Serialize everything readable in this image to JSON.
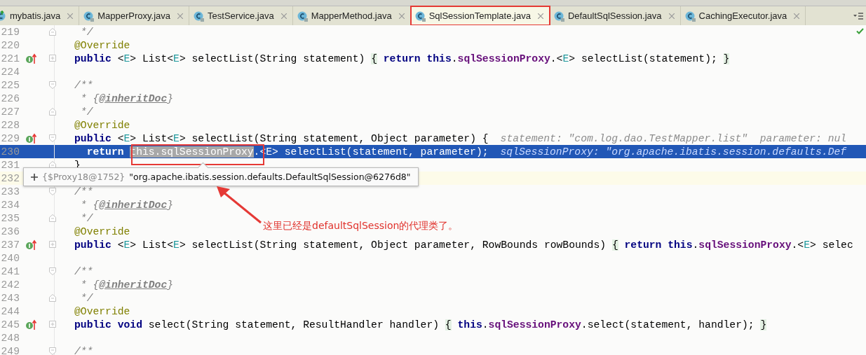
{
  "tabs": [
    {
      "label": "mybatis.java",
      "runnable": true,
      "selected": false,
      "highlighted": false
    },
    {
      "label": "MapperProxy.java",
      "runnable": false,
      "selected": false,
      "highlighted": false
    },
    {
      "label": "TestService.java",
      "runnable": false,
      "selected": false,
      "highlighted": false
    },
    {
      "label": "MapperMethod.java",
      "runnable": false,
      "selected": false,
      "highlighted": false
    },
    {
      "label": "SqlSessionTemplate.java",
      "runnable": false,
      "selected": true,
      "highlighted": true
    },
    {
      "label": "DefaultSqlSession.java",
      "runnable": false,
      "selected": false,
      "highlighted": false
    },
    {
      "label": "CachingExecutor.java",
      "runnable": false,
      "selected": false,
      "highlighted": false
    }
  ],
  "editor": {
    "lines": [
      {
        "number": "219",
        "implements": false,
        "fold_start": false,
        "fold_end": true,
        "collapsed": false,
        "selected": false,
        "caret": false,
        "tokens": [
          {
            "kind": "comment",
            "text": " */"
          }
        ]
      },
      {
        "number": "220",
        "implements": false,
        "fold_start": false,
        "fold_end": false,
        "collapsed": false,
        "selected": false,
        "caret": false,
        "tokens": [
          {
            "kind": "annotation",
            "text": "@Override"
          }
        ]
      },
      {
        "number": "221",
        "implements": true,
        "fold_start": false,
        "fold_end": false,
        "collapsed": true,
        "selected": false,
        "caret": false,
        "tokens": [
          {
            "kind": "keyword",
            "text": "public"
          },
          {
            "kind": "plain",
            "text": " <"
          },
          {
            "kind": "type",
            "text": "E"
          },
          {
            "kind": "plain",
            "text": "> List<"
          },
          {
            "kind": "type",
            "text": "E"
          },
          {
            "kind": "plain",
            "text": "> selectList(String statement) "
          },
          {
            "kind": "brace",
            "text": "{"
          },
          {
            "kind": "keyword",
            "text": " return this"
          },
          {
            "kind": "plain",
            "text": "."
          },
          {
            "kind": "field",
            "text": "sqlSessionProxy"
          },
          {
            "kind": "plain",
            "text": ".<"
          },
          {
            "kind": "type",
            "text": "E"
          },
          {
            "kind": "plain",
            "text": "> selectList(statement); "
          },
          {
            "kind": "brace",
            "text": "}"
          }
        ]
      },
      {
        "number": "224",
        "implements": false,
        "fold_start": false,
        "fold_end": false,
        "collapsed": false,
        "selected": false,
        "caret": false
      },
      {
        "number": "225",
        "implements": false,
        "fold_start": true,
        "fold_end": false,
        "collapsed": false,
        "selected": false,
        "caret": false,
        "tokens": [
          {
            "kind": "comment",
            "text": "/**"
          }
        ]
      },
      {
        "number": "226",
        "implements": false,
        "fold_start": false,
        "fold_end": false,
        "collapsed": false,
        "selected": false,
        "caret": false,
        "tokens": [
          {
            "kind": "comment",
            "text": " * {"
          },
          {
            "kind": "doctag",
            "text": "@inheritDoc"
          },
          {
            "kind": "comment",
            "text": "}"
          }
        ]
      },
      {
        "number": "227",
        "implements": false,
        "fold_start": false,
        "fold_end": true,
        "collapsed": false,
        "selected": false,
        "caret": false,
        "tokens": [
          {
            "kind": "comment",
            "text": " */"
          }
        ]
      },
      {
        "number": "228",
        "implements": false,
        "fold_start": false,
        "fold_end": false,
        "collapsed": false,
        "selected": false,
        "caret": false,
        "tokens": [
          {
            "kind": "annotation",
            "text": "@Override"
          }
        ]
      },
      {
        "number": "229",
        "implements": true,
        "fold_start": true,
        "fold_end": false,
        "collapsed": false,
        "selected": false,
        "caret": false,
        "tokens": [
          {
            "kind": "keyword",
            "text": "public"
          },
          {
            "kind": "plain",
            "text": " <"
          },
          {
            "kind": "type",
            "text": "E"
          },
          {
            "kind": "plain",
            "text": "> List<"
          },
          {
            "kind": "type",
            "text": "E"
          },
          {
            "kind": "plain",
            "text": "> selectList(String statement, Object parameter) {"
          }
        ],
        "hint": "statement: \"com.log.dao.TestMapper.list\"  parameter: nul"
      },
      {
        "number": "230",
        "implements": false,
        "fold_start": false,
        "fold_end": false,
        "collapsed": false,
        "selected": true,
        "caret": false,
        "tokens": [
          {
            "kind": "keyword",
            "text": "  return "
          },
          {
            "kind": "usage",
            "text": "this.sqlSessionProxy"
          },
          {
            "kind": "plain",
            "text": ".<E> selectList(statement, parameter);"
          }
        ],
        "hint": "sqlSessionProxy: \"org.apache.ibatis.session.defaults.Def"
      },
      {
        "number": "231",
        "implements": false,
        "fold_start": false,
        "fold_end": true,
        "collapsed": false,
        "selected": false,
        "caret": false,
        "tokens": [
          {
            "kind": "plain",
            "text": "}"
          }
        ]
      },
      {
        "number": "232",
        "implements": false,
        "fold_start": false,
        "fold_end": false,
        "collapsed": false,
        "selected": false,
        "caret": true
      },
      {
        "number": "233",
        "implements": false,
        "fold_start": true,
        "fold_end": false,
        "collapsed": false,
        "selected": false,
        "caret": false,
        "tokens": [
          {
            "kind": "comment",
            "text": "/**"
          }
        ]
      },
      {
        "number": "234",
        "implements": false,
        "fold_start": false,
        "fold_end": false,
        "collapsed": false,
        "selected": false,
        "caret": false,
        "tokens": [
          {
            "kind": "comment",
            "text": " * {"
          },
          {
            "kind": "doctag",
            "text": "@inheritDoc"
          },
          {
            "kind": "comment",
            "text": "}"
          }
        ]
      },
      {
        "number": "235",
        "implements": false,
        "fold_start": false,
        "fold_end": true,
        "collapsed": false,
        "selected": false,
        "caret": false,
        "tokens": [
          {
            "kind": "comment",
            "text": " */"
          }
        ]
      },
      {
        "number": "236",
        "implements": false,
        "fold_start": false,
        "fold_end": false,
        "collapsed": false,
        "selected": false,
        "caret": false,
        "tokens": [
          {
            "kind": "annotation",
            "text": "@Override"
          }
        ]
      },
      {
        "number": "237",
        "implements": true,
        "fold_start": false,
        "fold_end": false,
        "collapsed": true,
        "selected": false,
        "caret": false,
        "tokens": [
          {
            "kind": "keyword",
            "text": "public"
          },
          {
            "kind": "plain",
            "text": " <"
          },
          {
            "kind": "type",
            "text": "E"
          },
          {
            "kind": "plain",
            "text": "> List<"
          },
          {
            "kind": "type",
            "text": "E"
          },
          {
            "kind": "plain",
            "text": "> selectList(String statement, Object parameter, RowBounds rowBounds) "
          },
          {
            "kind": "brace",
            "text": "{"
          },
          {
            "kind": "keyword",
            "text": " return this"
          },
          {
            "kind": "plain",
            "text": "."
          },
          {
            "kind": "field",
            "text": "sqlSessionProxy"
          },
          {
            "kind": "plain",
            "text": ".<"
          },
          {
            "kind": "type",
            "text": "E"
          },
          {
            "kind": "plain",
            "text": "> selec"
          }
        ]
      },
      {
        "number": "240",
        "implements": false,
        "fold_start": false,
        "fold_end": false,
        "collapsed": false,
        "selected": false,
        "caret": false
      },
      {
        "number": "241",
        "implements": false,
        "fold_start": true,
        "fold_end": false,
        "collapsed": false,
        "selected": false,
        "caret": false,
        "tokens": [
          {
            "kind": "comment",
            "text": "/**"
          }
        ]
      },
      {
        "number": "242",
        "implements": false,
        "fold_start": false,
        "fold_end": false,
        "collapsed": false,
        "selected": false,
        "caret": false,
        "tokens": [
          {
            "kind": "comment",
            "text": " * {"
          },
          {
            "kind": "doctag",
            "text": "@inheritDoc"
          },
          {
            "kind": "comment",
            "text": "}"
          }
        ]
      },
      {
        "number": "243",
        "implements": false,
        "fold_start": false,
        "fold_end": true,
        "collapsed": false,
        "selected": false,
        "caret": false,
        "tokens": [
          {
            "kind": "comment",
            "text": " */"
          }
        ]
      },
      {
        "number": "244",
        "implements": false,
        "fold_start": false,
        "fold_end": false,
        "collapsed": false,
        "selected": false,
        "caret": false,
        "tokens": [
          {
            "kind": "annotation",
            "text": "@Override"
          }
        ]
      },
      {
        "number": "245",
        "implements": true,
        "fold_start": false,
        "fold_end": false,
        "collapsed": true,
        "selected": false,
        "caret": false,
        "tokens": [
          {
            "kind": "keyword",
            "text": "public void"
          },
          {
            "kind": "plain",
            "text": " select(String statement, ResultHandler handler) "
          },
          {
            "kind": "brace",
            "text": "{"
          },
          {
            "kind": "keyword",
            "text": " this"
          },
          {
            "kind": "plain",
            "text": "."
          },
          {
            "kind": "field",
            "text": "sqlSessionProxy"
          },
          {
            "kind": "plain",
            "text": ".select(statement, handler); "
          },
          {
            "kind": "brace",
            "text": "}"
          }
        ]
      },
      {
        "number": "248",
        "implements": false,
        "fold_start": false,
        "fold_end": false,
        "collapsed": false,
        "selected": false,
        "caret": false
      },
      {
        "number": "249",
        "implements": false,
        "fold_start": true,
        "fold_end": false,
        "collapsed": false,
        "selected": false,
        "caret": false,
        "tokens": [
          {
            "kind": "comment",
            "text": "/**"
          }
        ]
      }
    ]
  },
  "tooltip": {
    "type": "{$Proxy18@1752}",
    "value": "\"org.apache.ibatis.session.defaults.DefaultSqlSession@6276d8\""
  },
  "annotation": {
    "text": "这里已经是defaultSqlSession的代理类了。"
  }
}
